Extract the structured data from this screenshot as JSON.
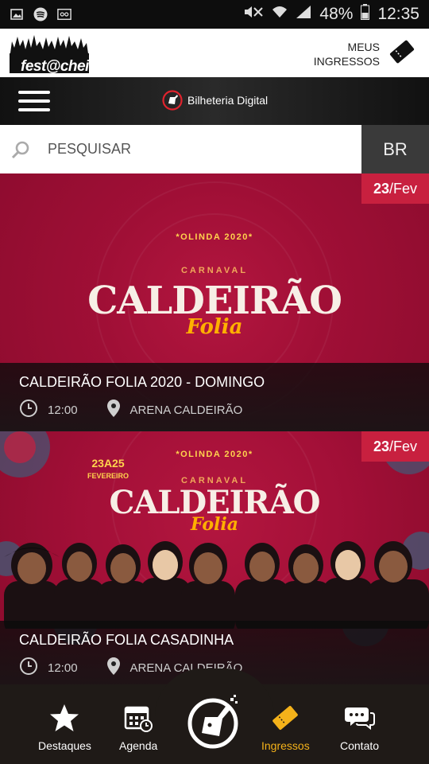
{
  "status_bar": {
    "battery": "48%",
    "time": "12:35"
  },
  "header": {
    "logo_text": "fest@cheia",
    "my_tickets_line1": "MEUS",
    "my_tickets_line2": "INGRESSOS"
  },
  "nav": {
    "brand": "Bilheteria Digital"
  },
  "search": {
    "placeholder": "PESQUISAR",
    "language": "BR"
  },
  "events": [
    {
      "day": "23",
      "month": "/Fev",
      "banner_top": "*OLINDA 2020*",
      "banner_carnaval": "CARNAVAL",
      "banner_title": "CALDEIRÃO",
      "banner_script": "Folia",
      "title": "CALDEIRÃO FOLIA 2020 - DOMINGO",
      "time": "12:00",
      "venue": "ARENA CALDEIRÃO"
    },
    {
      "day": "23",
      "month": "/Fev",
      "banner_dates": "23A25",
      "banner_dates_month": "FEVEREIRO",
      "banner_top": "*OLINDA 2020*",
      "banner_carnaval": "CARNAVAL",
      "banner_title": "CALDEIRÃO",
      "banner_script": "Folia",
      "title": "CALDEIRÃO FOLIA CASADINHA",
      "time": "12:00",
      "venue": "ARENA CALDEIRÃO"
    }
  ],
  "bottom_nav": {
    "items": [
      {
        "label": "Destaques",
        "icon": "star-icon"
      },
      {
        "label": "Agenda",
        "icon": "calendar-icon"
      },
      {
        "label": "Ingressos",
        "icon": "ticket-icon"
      },
      {
        "label": "Contato",
        "icon": "chat-icon"
      }
    ],
    "active": "Ingressos"
  },
  "colors": {
    "accent": "#f4b21a",
    "badge": "#c8203f",
    "banner": "#a00f36"
  }
}
